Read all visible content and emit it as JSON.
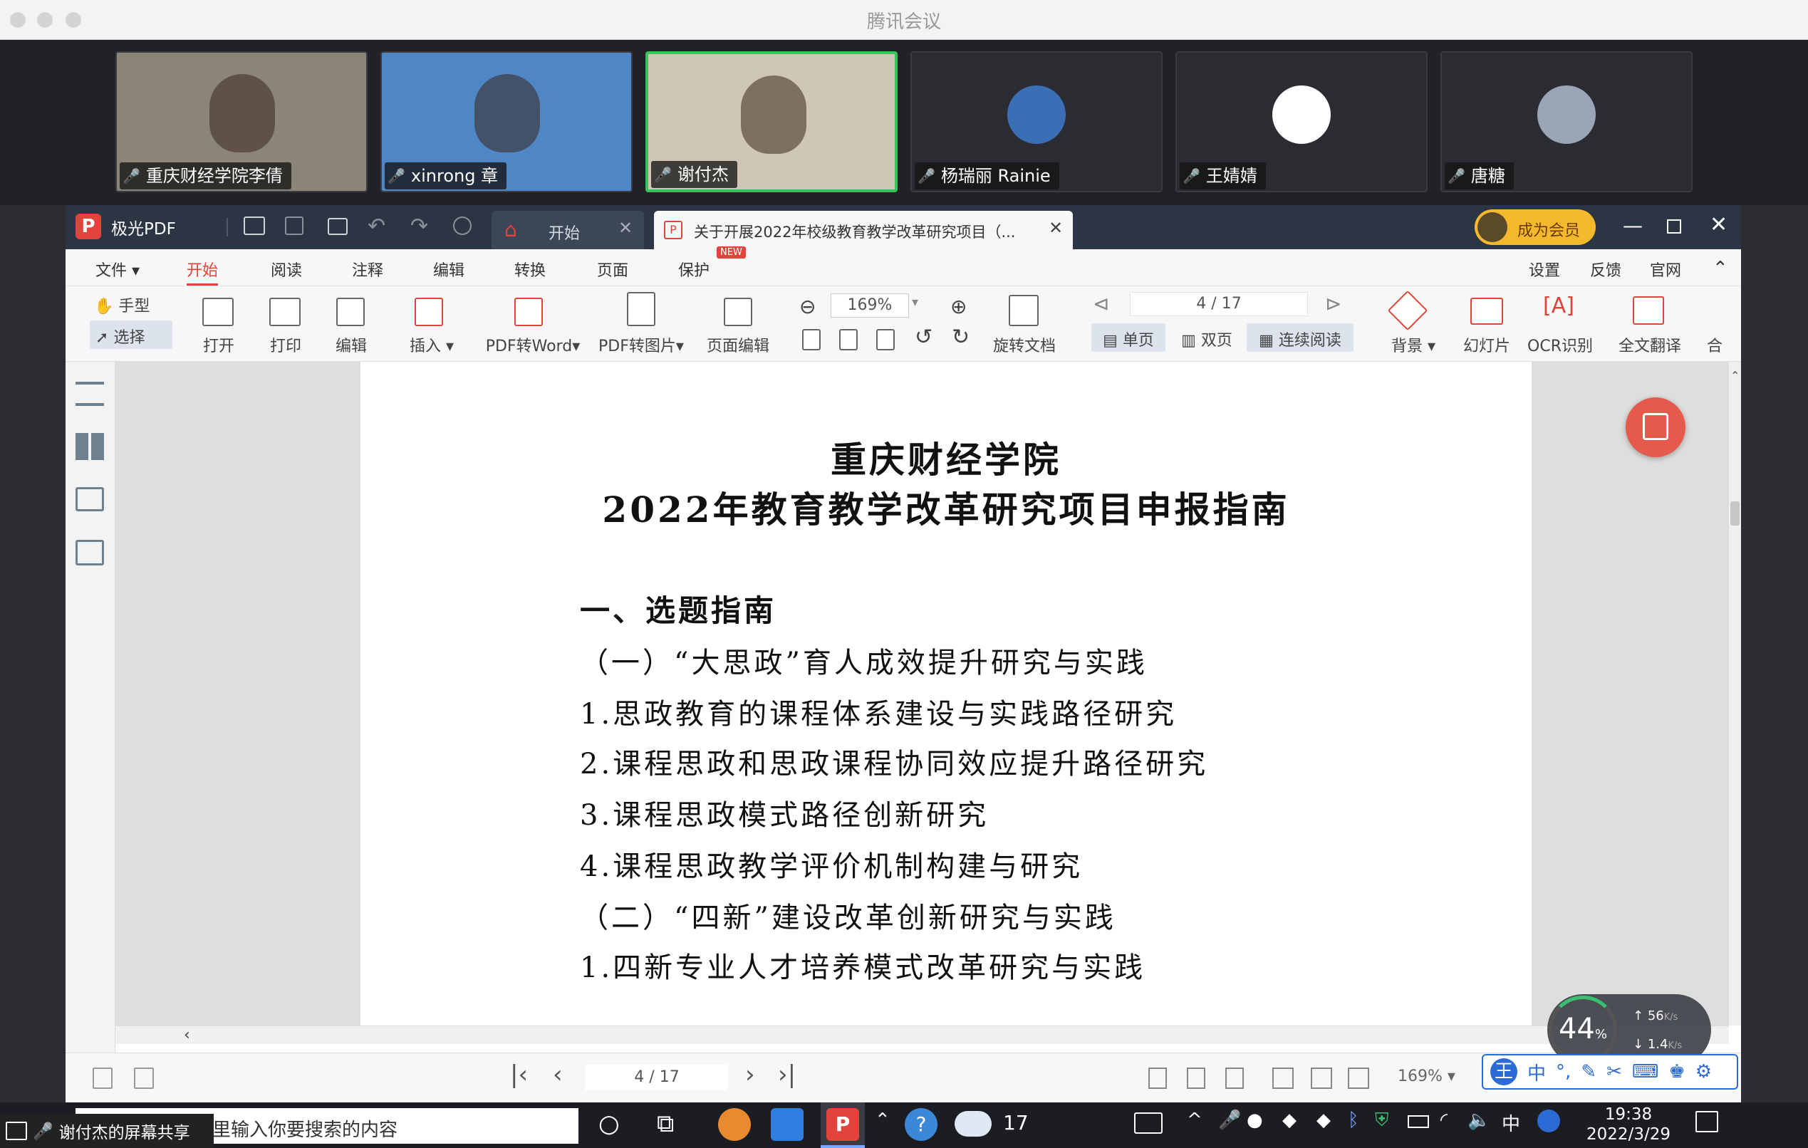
{
  "meeting": {
    "title": "腾讯会议"
  },
  "participants": [
    {
      "name": "重庆财经学院李倩",
      "muted": true,
      "active": false,
      "bg": "#8b8478"
    },
    {
      "name": "xinrong 章",
      "muted": false,
      "active": false,
      "bg": "#4f86c6"
    },
    {
      "name": "谢付杰",
      "muted": false,
      "active": true,
      "bg": "#cfc6b8"
    },
    {
      "name": "杨瑞丽 Rainie",
      "muted": true,
      "active": false,
      "bg": "#2a2c31"
    },
    {
      "name": "王婧婧",
      "muted": true,
      "active": false,
      "bg": "#2a2c31"
    },
    {
      "name": "唐糖",
      "muted": true,
      "active": false,
      "bg": "#2a2c31"
    }
  ],
  "app": {
    "name": "极光PDF",
    "tab_home": "开始",
    "tab_doc": "关于开展2022年校级教育教学改革研究项目（...",
    "member": "成为会员",
    "brand_color": "#e0443a"
  },
  "menu": {
    "file": "文件",
    "items": [
      "开始",
      "阅读",
      "注释",
      "编辑",
      "转换",
      "页面",
      "保护"
    ],
    "new_badge": "NEW",
    "right": [
      "设置",
      "反馈",
      "官网"
    ]
  },
  "ribbon": {
    "hand": "手型",
    "select": "选择",
    "open": "打开",
    "print": "打印",
    "edit": "编辑",
    "insert": "插入",
    "pdf2word": "PDF转Word",
    "pdf2img": "PDF转图片",
    "page_edit": "页面编辑",
    "zoom": "169%",
    "rotate": "旋转文档",
    "page": "4 / 17",
    "single": "单页",
    "double": "双页",
    "continuous": "连续阅读",
    "background": "背景",
    "slideshow": "幻灯片",
    "ocr": "OCR识别",
    "translate": "全文翻译",
    "merge": "合"
  },
  "document": {
    "title1": "重庆财经学院",
    "title2": "2022年教育教学改革研究项目申报指南",
    "section": "一、选题指南",
    "lines": [
      "（一）“大思政”育人成效提升研究与实践",
      "1.思政教育的课程体系建设与实践路径研究",
      "2.课程思政和思政课程协同效应提升路径研究",
      "3.课程思政模式路径创新研究",
      "4.课程思政教学评价机制构建与研究",
      "（二）“四新”建设改革创新研究与实践",
      "1.四新专业人才培养模式改革研究与实践"
    ]
  },
  "status": {
    "page": "4 / 17",
    "zoom": "169%"
  },
  "widget": {
    "percent": "44",
    "unit": "%",
    "up": "56",
    "up_unit": "K/s",
    "down": "1.4",
    "down_unit": "K/s"
  },
  "taskbar": {
    "share": "谢付杰的屏幕共享",
    "search_placeholder": "在这里输入你要搜索的内容",
    "weather": "17",
    "lang": "中",
    "time": "19:38",
    "date": "2022/3/29"
  },
  "ime": {
    "label": "王",
    "mode": "中"
  }
}
